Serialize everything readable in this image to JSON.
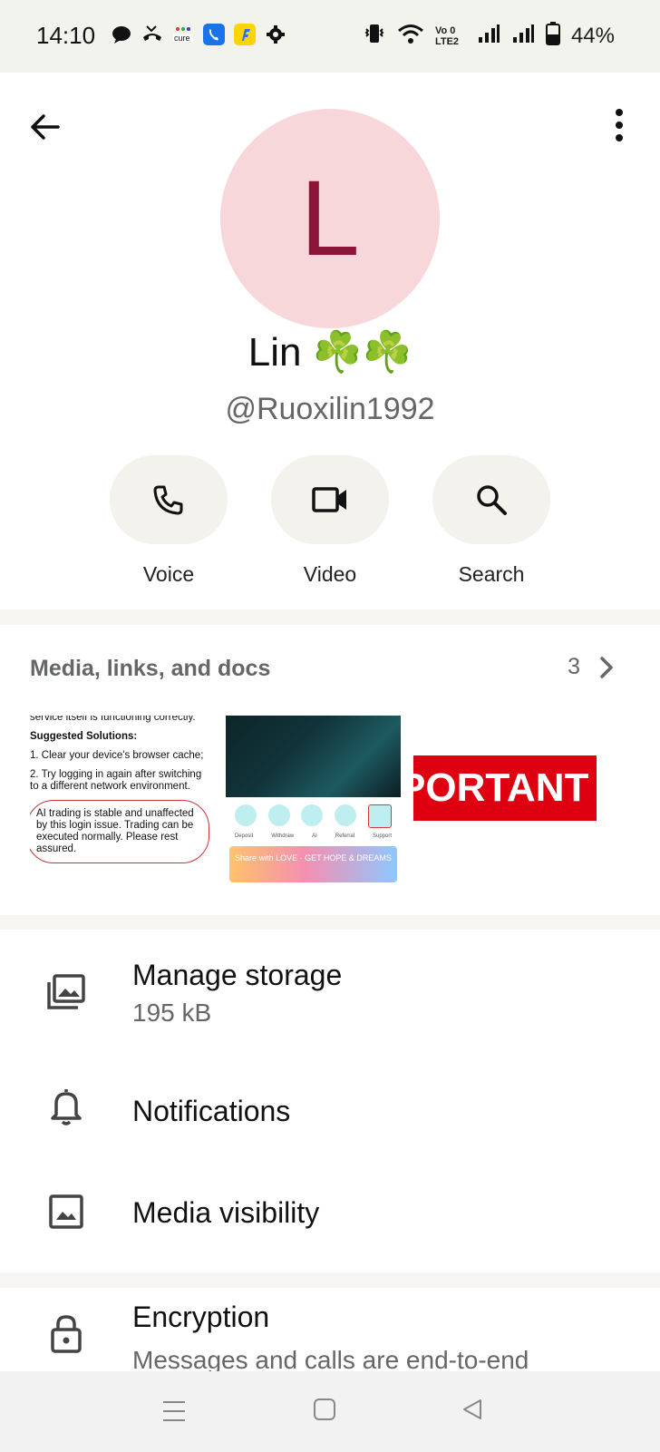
{
  "status_bar": {
    "time": "14:10",
    "left_icons": [
      "chat-bubble-icon",
      "missed-call-icon",
      "cure-app-icon",
      "phone-app-icon",
      "flipkart-app-icon",
      "gear-icon"
    ],
    "volte": "Vo 0 LTE2",
    "battery": "44%"
  },
  "profile": {
    "avatar_letter": "L",
    "name": "Lin ☘️☘️",
    "username": "@Ruoxilin1992"
  },
  "actions": {
    "voice": "Voice",
    "video": "Video",
    "search": "Search"
  },
  "media": {
    "title": "Media, links, and docs",
    "count": "3",
    "thumb1": {
      "line1": "service itself is functioning correctly.",
      "heading": "Suggested Solutions:",
      "item1": "1. Clear your device's browser cache;",
      "item2": "2. Try logging in again after switching to a different network environment.",
      "note": "AI trading is stable and unaffected by this login issue. Trading can be executed normally. Please rest assured."
    },
    "thumb2": {
      "labels": [
        "Deposit",
        "Withdraw",
        "AI",
        "Referral",
        "Support"
      ],
      "banner": "Share with LOVE · GET HOPE & DREAMS"
    },
    "thumb3": {
      "text": "PORTANT NOT"
    }
  },
  "settings": {
    "storage_title": "Manage storage",
    "storage_size": "195 kB",
    "notifications": "Notifications",
    "media_visibility": "Media visibility",
    "encryption_title": "Encryption",
    "encryption_sub": "Messages and calls are end-to-end"
  },
  "colors": {
    "avatar_bg": "#f8d7db",
    "avatar_letter": "#8a1538",
    "pill_bg": "#f3f2ec"
  }
}
